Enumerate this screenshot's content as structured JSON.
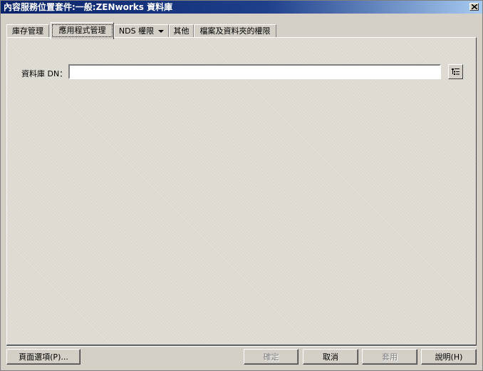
{
  "window": {
    "title": "內容服務位置套件:一般:ZENworks 資料庫"
  },
  "tabs": [
    {
      "label": "庫存管理"
    },
    {
      "label": "應用程式管理",
      "active": true
    },
    {
      "label": "NDS 權限",
      "has_dropdown": true
    },
    {
      "label": "其他"
    },
    {
      "label": "檔案及資料夾的權限"
    }
  ],
  "form": {
    "database_dn_label": "資料庫 DN：",
    "database_dn_value": ""
  },
  "buttons": {
    "page_options": "頁面選項(P)...",
    "ok": "確定",
    "cancel": "取消",
    "apply": "套用",
    "help": "說明(H)"
  },
  "icons": {
    "close": "close-icon",
    "browse": "browse-tree-icon",
    "dropdown": "caret-down-icon"
  }
}
